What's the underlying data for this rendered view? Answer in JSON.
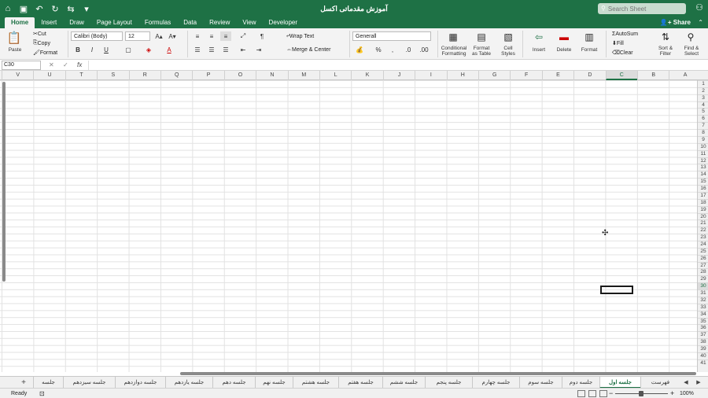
{
  "title": "آموزش مقدماتی اکسل",
  "search": {
    "placeholder": "Search Sheet"
  },
  "tabs": [
    "Home",
    "Insert",
    "Draw",
    "Page Layout",
    "Formulas",
    "Data",
    "Review",
    "View",
    "Developer"
  ],
  "share": "Share",
  "ribbon": {
    "paste": "Paste",
    "cut": "Cut",
    "copy": "Copy",
    "format": "Format",
    "font": "Calibri (Body)",
    "size": "12",
    "wrap": "Wrap Text",
    "merge": "Merge & Center",
    "numfmt": "Generall",
    "cond": [
      "Conditional",
      "Formatting"
    ],
    "fmt_table": [
      "Format",
      "as Table"
    ],
    "cell_styles": [
      "Cell",
      "Styles"
    ],
    "insert": "Insert",
    "delete": "Delete",
    "format2": "Format",
    "autosum": "AutoSum",
    "fill": "Fill",
    "clear": "Clear",
    "sort": [
      "Sort &",
      "Filter"
    ],
    "find": [
      "Find &",
      "Select"
    ],
    "bold": "B",
    "italic": "I",
    "underline": "U",
    "percent": "%",
    "comma": ","
  },
  "formula": {
    "namebox": "C30",
    "fx": "fx",
    "value": ""
  },
  "columns": [
    "V",
    "U",
    "T",
    "S",
    "R",
    "Q",
    "P",
    "O",
    "N",
    "M",
    "L",
    "K",
    "J",
    "I",
    "H",
    "G",
    "F",
    "E",
    "D",
    "C",
    "B",
    "A"
  ],
  "selected_column": "C",
  "rows": [
    "1",
    "2",
    "3",
    "4",
    "5",
    "6",
    "7",
    "8",
    "9",
    "10",
    "11",
    "12",
    "13",
    "14",
    "15",
    "16",
    "17",
    "18",
    "19",
    "20",
    "21",
    "22",
    "23",
    "24",
    "25",
    "26",
    "27",
    "28",
    "29",
    "30",
    "31",
    "32",
    "33",
    "34",
    "35",
    "36",
    "37",
    "38",
    "39",
    "40",
    "41"
  ],
  "selected_row": "30",
  "sheets": [
    "جلسه",
    "جلسه سیزدهم",
    "جلسه دوازدهم",
    "جلسه یازدهم",
    "جلسه دهم",
    "جلسه نهم",
    "جلسه هشتم",
    "جلسه هفتم",
    "جلسه ششم",
    "جلسه پنجم",
    "جلسه چهارم",
    "جلسه سوم",
    "جلسه دوم",
    "جلسه اول",
    "فهرست"
  ],
  "active_sheet": "جلسه اول",
  "status": {
    "ready": "Ready",
    "zoom": "100%"
  }
}
